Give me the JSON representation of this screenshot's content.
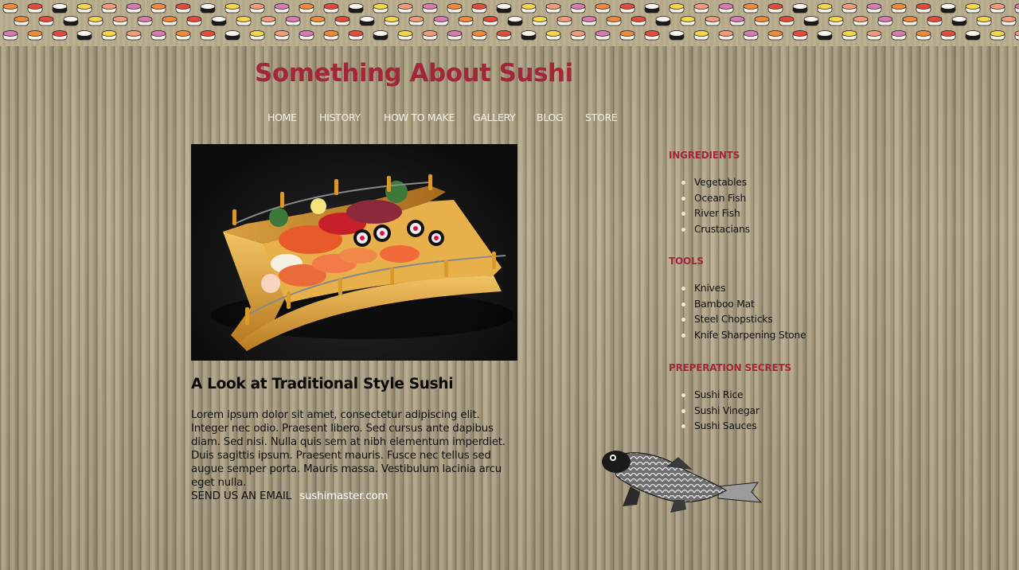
{
  "site": {
    "title": "Something About Sushi"
  },
  "nav": {
    "items": [
      {
        "label": "HOME"
      },
      {
        "label": "HISTORY"
      },
      {
        "label": "HOW TO MAKE"
      },
      {
        "label": "GALLERY"
      },
      {
        "label": "BLOG"
      },
      {
        "label": "STORE"
      }
    ]
  },
  "article": {
    "title": "A Look at Traditional Style Sushi",
    "body": "Lorem ipsum dolor sit amet, consectetur adipiscing elit. Integer nec odio. Praesent libero. Sed cursus ante dapibus diam. Sed nisi. Nulla quis sem at nibh elementum imperdiet. Duis sagittis ipsum. Praesent mauris. Fusce nec tellus sed augue semper porta. Mauris massa. Vestibulum lacinia arcu eget nulla.",
    "email_label": "SEND US AN EMAIL",
    "email_link": "sushimaster.com"
  },
  "sidebar": {
    "sections": [
      {
        "heading": "INGREDIENTS",
        "items": [
          "Vegetables",
          "Ocean Fish",
          "River Fish",
          "Crustacians"
        ]
      },
      {
        "heading": "TOOLS",
        "items": [
          "Knives",
          "Bamboo Mat",
          "Steel Chopsticks",
          "Knife Sharpening Stone"
        ]
      },
      {
        "heading": "PREPERATION SECRETS",
        "items": [
          "Sushi Rice",
          "Sushi Vinegar",
          "Sushi Sauces"
        ]
      }
    ]
  },
  "colors": {
    "accent": "#a4263a",
    "nav_text": "#f4f1ea",
    "body_text": "#111111",
    "email_link": "#ffffff"
  },
  "icons": {
    "banner": "sushi-pattern-icon",
    "hero": "sushi-boat-icon",
    "decoration": "koi-fish-icon"
  }
}
